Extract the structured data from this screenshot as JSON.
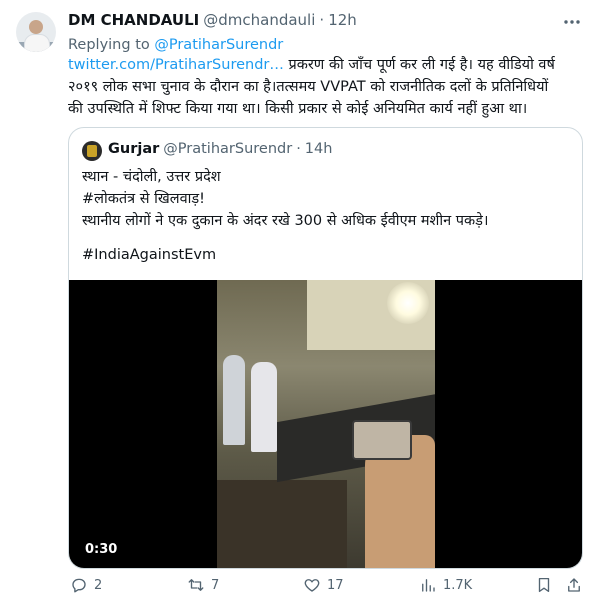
{
  "tweet": {
    "author_name": "DM CHANDAULI",
    "author_handle": "@dmchandauli",
    "separator": "·",
    "time": "12h",
    "replying_prefix": "Replying to",
    "replying_to": "@PratiharSurendr",
    "link_text": "twitter.com/PratiharSurendr…",
    "body_line1": "प्रकरण की जाँच पूर्ण कर ली गई है। यह वीडियो वर्ष",
    "body_line2": "२०१९ लोक सभा चुनाव के दौरान का है।तत्समय VVPAT को राजनीतिक दलों के प्रतिनिधियों",
    "body_line3": "की उपस्थिति में शिफ्ट किया गया था। किसी प्रकार से कोई अनियमित कार्य नहीं हुआ था।"
  },
  "quoted": {
    "author_name": "Gurjar",
    "author_handle": "@PratiharSurendr",
    "separator": "·",
    "time": "14h",
    "line1": "स्थान - चंदोली, उत्तर प्रदेश",
    "line2": "#लोकतंत्र से खिलवाड़!",
    "line3": "स्थानीय लोगों ने एक दुकान के अंदर रखे 300 से अधिक ईवीएम मशीन पकड़े।",
    "line4": "#IndiaAgainstEvm",
    "video_duration": "0:30"
  },
  "actions": {
    "replies": "2",
    "retweets": "7",
    "likes": "17",
    "views": "1.7K"
  },
  "colors": {
    "link": "#1d9bf0",
    "secondary_text": "#536471",
    "border": "#cfd9de"
  },
  "icons": [
    "more-icon",
    "reply-icon",
    "retweet-icon",
    "like-icon",
    "views-icon",
    "bookmark-icon",
    "share-icon"
  ]
}
